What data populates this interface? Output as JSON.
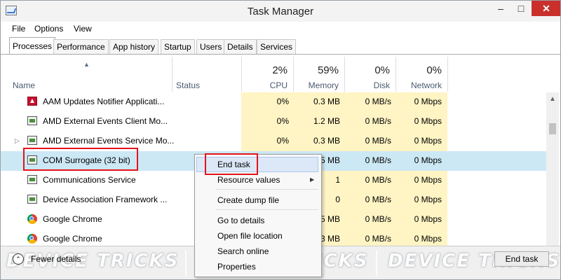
{
  "window": {
    "title": "Task Manager",
    "minimize": "–",
    "maximize": "□",
    "close": "✕"
  },
  "menu": [
    "File",
    "Options",
    "View"
  ],
  "tabs": [
    "Processes",
    "Performance",
    "App history",
    "Startup",
    "Users",
    "Details",
    "Services"
  ],
  "active_tab": "Processes",
  "columns": {
    "name": "Name",
    "status": "Status",
    "cpu": {
      "pct": "2%",
      "label": "CPU"
    },
    "memory": {
      "pct": "59%",
      "label": "Memory"
    },
    "disk": {
      "pct": "0%",
      "label": "Disk"
    },
    "network": {
      "pct": "0%",
      "label": "Network"
    }
  },
  "rows": [
    {
      "name": "AAM Updates Notifier Applicati...",
      "icon": "adobe-icon",
      "cpu": "0%",
      "memory": "0.3 MB",
      "disk": "0 MB/s",
      "network": "0 Mbps"
    },
    {
      "name": "AMD External Events Client Mo...",
      "icon": "window-icon",
      "cpu": "0%",
      "memory": "1.2 MB",
      "disk": "0 MB/s",
      "network": "0 Mbps"
    },
    {
      "name": "AMD External Events Service Mo...",
      "icon": "window-icon",
      "cpu": "0%",
      "memory": "0.3 MB",
      "disk": "0 MB/s",
      "network": "0 Mbps"
    },
    {
      "name": "COM Surrogate (32 bit)",
      "icon": "window-icon",
      "cpu": "",
      "memory": "5 MB",
      "disk": "0 MB/s",
      "network": "0 Mbps"
    },
    {
      "name": "Communications Service",
      "icon": "window-icon",
      "cpu": "",
      "memory": "1",
      "disk": "0 MB/s",
      "network": "0 Mbps"
    },
    {
      "name": "Device Association Framework ...",
      "icon": "window-icon",
      "cpu": "",
      "memory": "0",
      "disk": "0 MB/s",
      "network": "0 Mbps"
    },
    {
      "name": "Google Chrome",
      "icon": "chrome-icon",
      "cpu": "",
      "memory": "5 MB",
      "disk": "0 MB/s",
      "network": "0 Mbps"
    },
    {
      "name": "Google Chrome",
      "icon": "chrome-icon",
      "cpu": "",
      "memory": "3 MB",
      "disk": "0 MB/s",
      "network": "0 Mbps"
    }
  ],
  "context_menu": [
    "End task",
    "Resource values",
    "Create dump file",
    "Go to details",
    "Open file location",
    "Search online",
    "Properties"
  ],
  "footer": {
    "fewer_details": "Fewer details",
    "end_task": "End task"
  },
  "watermark": {
    "text": "DEVICE TRICKS",
    "color": "#ffffff"
  },
  "colors": {
    "selection": "#cce8f5",
    "heat": "#fff4c4",
    "highlight_box": "#e3141a",
    "close_button": "#c9302c"
  }
}
